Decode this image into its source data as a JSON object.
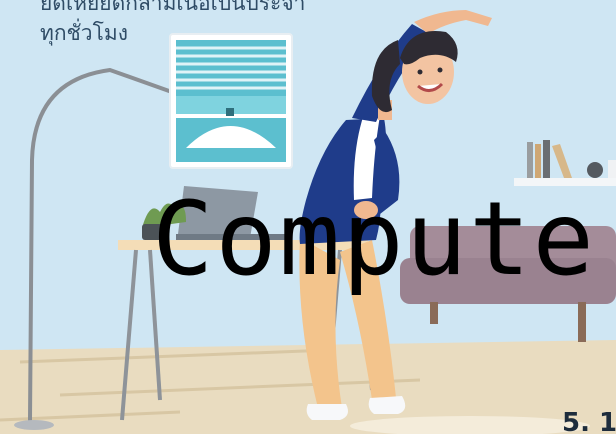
{
  "caption": {
    "line1": "ยืดเหยียดกล้ามเนื้อเป็นประจำ",
    "line2": "ทุกชั่วโมง"
  },
  "overlay_word": "Compute",
  "footer_number": "5. 1",
  "colors": {
    "background": "#cfe6f3",
    "floor": "#e9dcc0",
    "jacket": "#1f3c8a",
    "pants": "#f3c48c",
    "sofa": "#9a8290",
    "window": "#5cbfcf",
    "text": "#2f4c66"
  },
  "icons": {
    "lamp": "floor-lamp-icon",
    "window": "window-blinds-icon",
    "plant": "potted-plant-icon",
    "laptop": "laptop-icon",
    "books": "bookshelf-icon"
  }
}
